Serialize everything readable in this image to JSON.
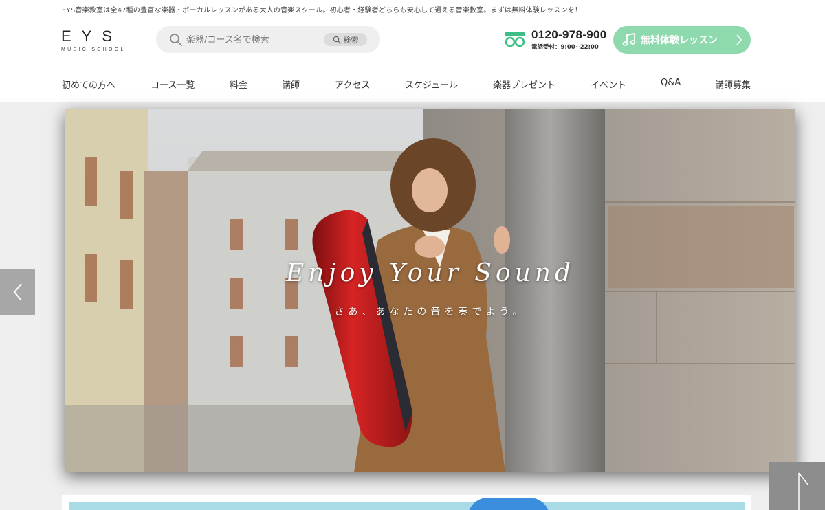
{
  "header": {
    "tagline": "EYS音楽教室は全47種の豊富な楽器・ボーカルレッスンがある大人の音楽スクール。初心者・経験者どちらも安心して通える音楽教室。まずは無料体験レッスンを！",
    "logo_main": "EYS",
    "logo_sub": "MUSIC SCHOOL",
    "search": {
      "placeholder": "楽器/コース名で検索",
      "button_label": "検索"
    },
    "phone": {
      "number": "0120-978-900",
      "hours": "電話受付：9:00~22:00",
      "icon": "freedial-icon"
    },
    "cta": {
      "label": "無料体験レッスン",
      "color": "#8fd9ae"
    }
  },
  "nav": {
    "items": [
      {
        "label": "初めての方へ"
      },
      {
        "label": "コース一覧"
      },
      {
        "label": "料金"
      },
      {
        "label": "講師"
      },
      {
        "label": "アクセス"
      },
      {
        "label": "スケジュール"
      },
      {
        "label": "楽器プレゼント"
      },
      {
        "label": "イベント"
      },
      {
        "label": "Q&A"
      },
      {
        "label": "講師募集"
      }
    ]
  },
  "hero": {
    "headline": "Enjoy Your Sound",
    "subheadline": "さあ、あなたの音を奏でよう。"
  },
  "colors": {
    "accent_green": "#8fd9ae",
    "case_red": "#c41b1b",
    "coat_brown": "#9a6a3f"
  }
}
